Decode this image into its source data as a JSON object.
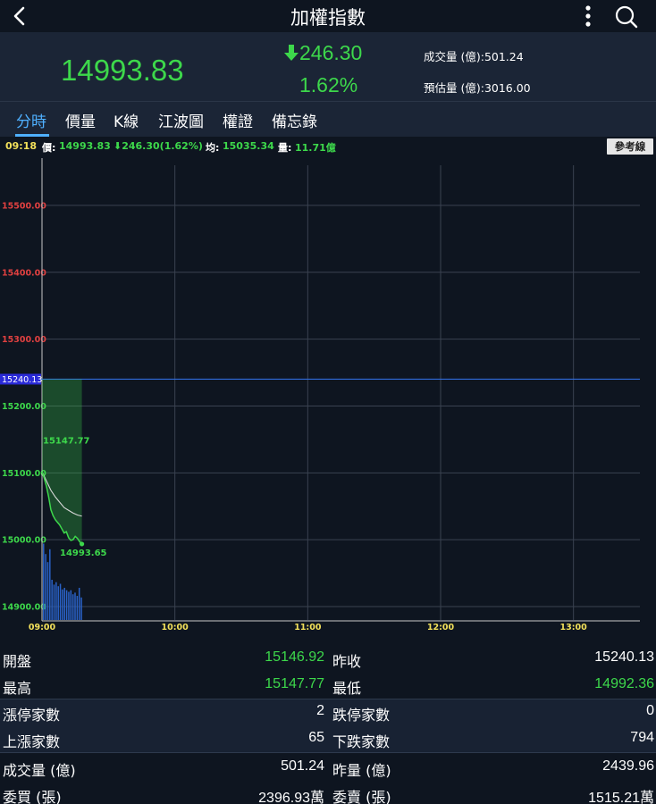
{
  "header": {
    "title": "加權指數",
    "back_icon": "chevron-left-icon",
    "more_icon": "vertical-dots-icon",
    "search_icon": "search-icon"
  },
  "quote": {
    "price": "14993.83",
    "change": "246.30",
    "change_direction": "down",
    "percent": "1.62%",
    "volume_label": "成交量 (億):501.24",
    "estimated_label": "預估量 (億):3016.00",
    "color": "#3dd84b"
  },
  "tabs": [
    {
      "label": "分時",
      "active": true
    },
    {
      "label": "價量"
    },
    {
      "label": "K線"
    },
    {
      "label": "江波圖"
    },
    {
      "label": "權證"
    },
    {
      "label": "備忘錄"
    }
  ],
  "info": {
    "time": "09:18",
    "price_label": "價:",
    "price": "14993.83",
    "change": "246.30(1.62%)",
    "avg_label": "均:",
    "avg": "15035.34",
    "vol_label": "量:",
    "vol": "11.71億",
    "ref_button": "參考線"
  },
  "chart_data": {
    "type": "line",
    "y_ticks": [
      "15500.00",
      "15400.00",
      "15300.00",
      "15200.00",
      "15100.00",
      "15000.00",
      "14900.00"
    ],
    "y_tick_values": [
      15500,
      15400,
      15300,
      15200,
      15100,
      15000,
      14900
    ],
    "x_ticks": [
      "09:00",
      "10:00",
      "11:00",
      "12:00",
      "13:00"
    ],
    "reference_label": "15240.13",
    "reference_value": 15240.13,
    "high_label": "15147.77",
    "high_value": 15147.77,
    "last_label": "14993.65",
    "last_value": 14993.65,
    "ylim": [
      14880,
      15560
    ],
    "price_series": {
      "name": "價",
      "minutes": [
        0,
        1,
        2,
        3,
        4,
        5,
        6,
        7,
        8,
        9,
        10,
        11,
        12,
        13,
        14,
        15,
        16,
        17,
        18
      ],
      "values": [
        15102,
        15092,
        15080,
        15064,
        15045,
        15036,
        15030,
        15026,
        15022,
        15016,
        15010,
        15012,
        15003,
        14999,
        15000,
        15005,
        15002,
        14997,
        14993.65
      ]
    },
    "avg_series": {
      "name": "均",
      "minutes": [
        0,
        2,
        4,
        6,
        8,
        10,
        12,
        14,
        16,
        18
      ],
      "values": [
        15102,
        15088,
        15074,
        15064,
        15056,
        15048,
        15044,
        15040,
        15037,
        15035.34
      ]
    },
    "volume_bars": [
      0.95,
      0.82,
      0.72,
      0.88,
      0.5,
      0.44,
      0.47,
      0.42,
      0.45,
      0.38,
      0.4,
      0.37,
      0.35,
      0.37,
      0.32,
      0.34,
      0.3,
      0.4,
      0.28
    ],
    "colors": {
      "up": "#e04040",
      "down": "#3dd84b",
      "grid": "#3a4250",
      "ref": "#2f6ad8",
      "volume": "#2a62c8",
      "avg": "#d8d8d8"
    }
  },
  "stats": {
    "rows": [
      {
        "l1": "開盤",
        "v1": "15146.92",
        "v1_green": true,
        "l2": "昨收",
        "v2": "15240.13",
        "v2_green": false
      },
      {
        "l1": "最高",
        "v1": "15147.77",
        "v1_green": true,
        "l2": "最低",
        "v2": "14992.36",
        "v2_green": true
      },
      {
        "l1": "漲停家數",
        "v1": "2",
        "l2": "跌停家數",
        "v2": "0"
      },
      {
        "l1": "上漲家數",
        "v1": "65",
        "l2": "下跌家數",
        "v2": "794"
      },
      {
        "l1": "成交量 (億)",
        "v1": "501.24",
        "l2": "昨量 (億)",
        "v2": "2439.96"
      },
      {
        "l1": "委買 (張)",
        "v1": "2396.93萬",
        "l2": "委賣 (張)",
        "v2": "1515.21萬"
      }
    ]
  }
}
